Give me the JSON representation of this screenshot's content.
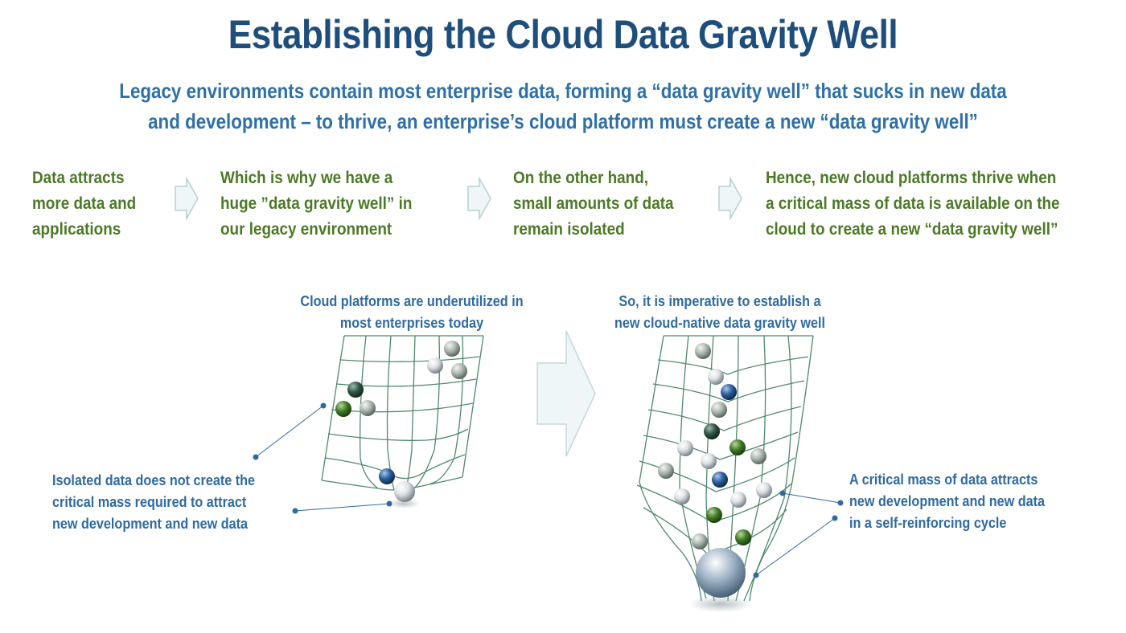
{
  "title": "Establishing the Cloud Data Gravity Well",
  "subtitle": {
    "line1": "Legacy environments contain most enterprise data, forming a “data gravity well” that sucks in new data",
    "line2": "and development – to thrive, an enterprise’s cloud platform must create a new “data gravity well”"
  },
  "steps": [
    {
      "lines": [
        "Data attracts",
        "more data and",
        "applications"
      ]
    },
    {
      "lines": [
        "Which is why we have a",
        "huge ”data gravity well” in",
        "our legacy environment"
      ]
    },
    {
      "lines": [
        "On the other hand,",
        "small amounts of data",
        "remain isolated"
      ]
    },
    {
      "lines": [
        "Hence, new cloud platforms thrive when",
        "a critical mass of data is available on the",
        "cloud to create a new “data gravity well”"
      ]
    }
  ],
  "left_panel": {
    "top_caption": [
      "Cloud platforms are underutilized in",
      "most enterprises today"
    ],
    "bottom_caption": [
      "Isolated data does not create the",
      "critical mass required to attract",
      "new development and new data"
    ]
  },
  "right_panel": {
    "top_caption": [
      "So, it is imperative to establish a",
      "new cloud-native data gravity well"
    ],
    "side_caption": [
      "A critical mass of data attracts",
      "new development and new data",
      "in a self-reinforcing cycle"
    ]
  },
  "colors": {
    "title": "#1e4e7c",
    "subtitle": "#2e70a8",
    "steps": "#4b7a26",
    "captions": "#2f6aa2",
    "grid": "#4f8a6e",
    "arrow_fill": "#eef6f7",
    "arrow_stroke": "#b9cfd4"
  }
}
